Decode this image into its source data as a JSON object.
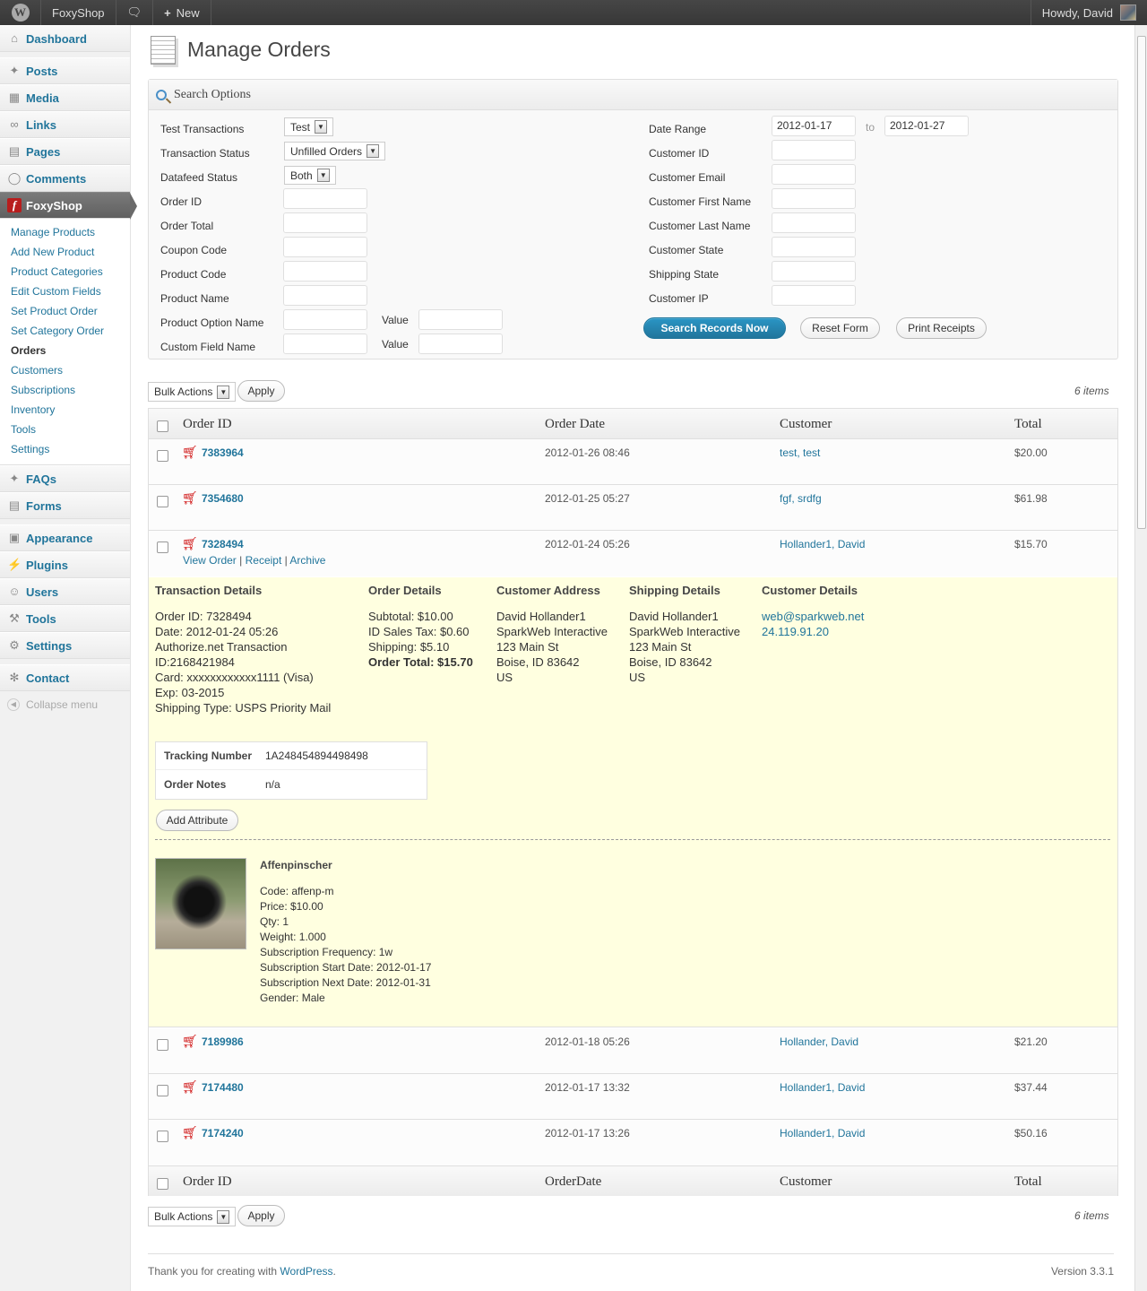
{
  "adminbar": {
    "site": "FoxyShop",
    "new": "New",
    "howdy": "Howdy, David"
  },
  "sidebar": {
    "top": [
      {
        "label": "Dashboard",
        "icon": "dashboard-icon"
      },
      {
        "label": "Posts",
        "icon": "pin-icon"
      },
      {
        "label": "Media",
        "icon": "media-icon"
      },
      {
        "label": "Links",
        "icon": "link-icon"
      },
      {
        "label": "Pages",
        "icon": "pages-icon"
      },
      {
        "label": "Comments",
        "icon": "comment-icon"
      }
    ],
    "foxyshop": "FoxyShop",
    "submenu": [
      "Manage Products",
      "Add New Product",
      "Product Categories",
      "Edit Custom Fields",
      "Set Product Order",
      "Set Category Order",
      "Orders",
      "Customers",
      "Subscriptions",
      "Inventory",
      "Tools",
      "Settings"
    ],
    "mid": [
      "FAQs",
      "Forms"
    ],
    "bottom": [
      "Appearance",
      "Plugins",
      "Users",
      "Tools",
      "Settings"
    ],
    "contact": "Contact",
    "collapse": "Collapse menu"
  },
  "page": {
    "title": "Manage Orders"
  },
  "search": {
    "heading": "Search Options",
    "left": {
      "test_transactions": "Test Transactions",
      "test_value": "Test",
      "transaction_status": "Transaction Status",
      "status_value": "Unfilled Orders",
      "datafeed_status": "Datafeed Status",
      "datafeed_value": "Both",
      "order_id": "Order ID",
      "order_total": "Order Total",
      "coupon_code": "Coupon Code",
      "product_code": "Product Code",
      "product_name": "Product Name",
      "product_option_name": "Product Option Name",
      "custom_field_name": "Custom Field Name",
      "value": "Value"
    },
    "right": {
      "date_range": "Date Range",
      "date_from": "2012-01-17",
      "to": "to",
      "date_to": "2012-01-27",
      "customer_id": "Customer ID",
      "customer_email": "Customer Email",
      "customer_first_name": "Customer First Name",
      "customer_last_name": "Customer Last Name",
      "customer_state": "Customer State",
      "shipping_state": "Shipping State",
      "customer_ip": "Customer IP"
    },
    "buttons": {
      "search": "Search Records Now",
      "reset": "Reset Form",
      "print": "Print Receipts"
    }
  },
  "bulk": {
    "label": "Bulk Actions",
    "apply": "Apply",
    "count": "6 items"
  },
  "table": {
    "headers": {
      "order_id": "Order ID",
      "order_date": "Order Date",
      "customer": "Customer",
      "total": "Total"
    },
    "footer_headers": {
      "order_id": "Order ID",
      "order_date": "OrderDate",
      "customer": "Customer",
      "total": "Total"
    },
    "rows": [
      {
        "id": "7383964",
        "date": "2012-01-26 08:46",
        "customer": "test, test",
        "total": "$20.00"
      },
      {
        "id": "7354680",
        "date": "2012-01-25 05:27",
        "customer": "fgf, srdfg",
        "total": "$61.98"
      },
      {
        "id": "7328494",
        "date": "2012-01-24 05:26",
        "customer": "Hollander1, David",
        "total": "$15.70"
      },
      {
        "id": "7189986",
        "date": "2012-01-18 05:26",
        "customer": "Hollander, David",
        "total": "$21.20"
      },
      {
        "id": "7174480",
        "date": "2012-01-17 13:32",
        "customer": "Hollander1, David",
        "total": "$37.44"
      },
      {
        "id": "7174240",
        "date": "2012-01-17 13:26",
        "customer": "Hollander1, David",
        "total": "$50.16"
      }
    ],
    "actions": {
      "view": "View Order",
      "receipt": "Receipt",
      "archive": "Archive"
    }
  },
  "details": {
    "transaction": {
      "heading": "Transaction Details",
      "lines": [
        "Order ID: 7328494",
        "Date: 2012-01-24 05:26",
        "Authorize.net Transaction",
        "ID:2168421984",
        "Card: xxxxxxxxxxxx1111 (Visa)",
        "Exp: 03-2015",
        "Shipping Type: USPS Priority Mail"
      ]
    },
    "order": {
      "heading": "Order Details",
      "lines": [
        "Subtotal: $10.00",
        "ID Sales Tax: $0.60",
        "Shipping: $5.10"
      ],
      "total": "Order Total: $15.70"
    },
    "customer_address": {
      "heading": "Customer Address",
      "lines": [
        "David Hollander1",
        "SparkWeb Interactive",
        "123 Main St",
        "Boise, ID 83642",
        "US"
      ]
    },
    "shipping": {
      "heading": "Shipping Details",
      "lines": [
        "David Hollander1",
        "SparkWeb Interactive",
        "123 Main St",
        "Boise, ID 83642",
        "US"
      ]
    },
    "customer": {
      "heading": "Customer Details",
      "email": "web@sparkweb.net",
      "ip": "24.119.91.20"
    },
    "tracking_label": "Tracking Number",
    "tracking_value": "1A248454894498498",
    "notes_label": "Order Notes",
    "notes_value": "n/a",
    "add_attribute": "Add Attribute",
    "product": {
      "name": "Affenpinscher",
      "lines": [
        "Code: affenp-m",
        "Price: $10.00",
        "Qty: 1",
        "Weight: 1.000",
        "Subscription Frequency: 1w",
        "Subscription Start Date: 2012-01-17",
        "Subscription Next Date: 2012-01-31",
        "Gender: Male"
      ]
    }
  },
  "footer": {
    "thanks": "Thank you for creating with ",
    "wp": "WordPress",
    "dot": ".",
    "version": "Version 3.3.1"
  }
}
